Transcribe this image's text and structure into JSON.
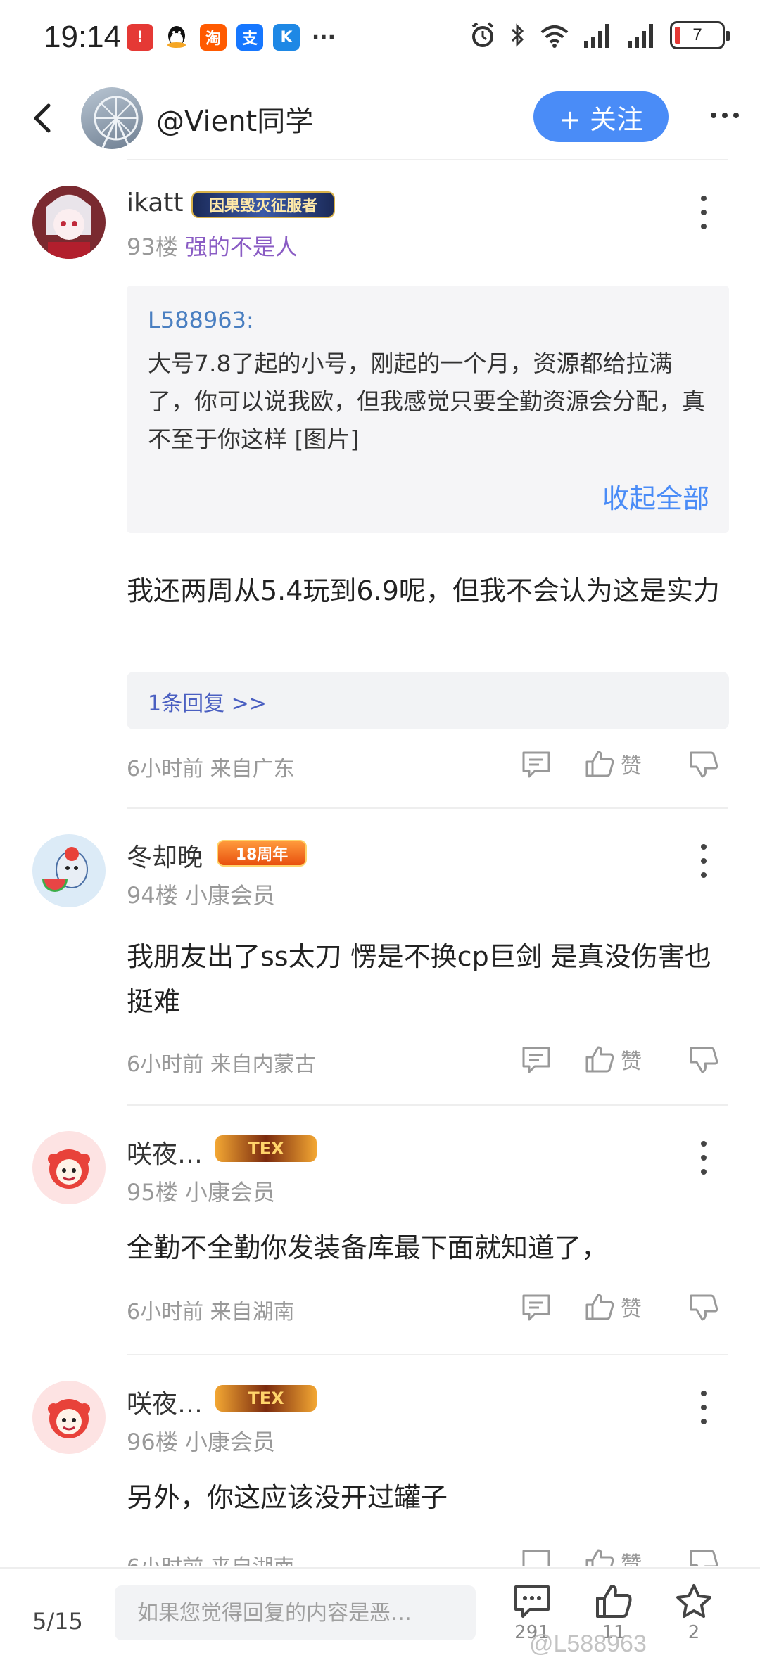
{
  "status_bar": {
    "time": "19:14",
    "notification_icons": [
      "warning-icon",
      "qq-icon",
      "taobao-icon",
      "alipay-icon",
      "app-icon",
      "more-dots-icon"
    ],
    "battery": "7"
  },
  "header": {
    "title": "@Vient同学",
    "follow_label": "+ 关注"
  },
  "posts": [
    {
      "username": "ikatt",
      "badge": "因果毁灭征服者",
      "floor": "93楼",
      "tag": "强的不是人",
      "quote": {
        "author": "L588963:",
        "text": "大号7.8了起的小号，刚起的一个月，资源都给拉满了，你可以说我欧，但我感觉只要全勤资源会分配，真不至于你这样 [图片]",
        "collapse_label": "收起全部"
      },
      "content": "我还两周从5.4玩到6.9呢，但我不会认为这是实力",
      "reply_link": "1条回复 >>",
      "time": "6小时前",
      "location": "来自广东",
      "like_label": "赞"
    },
    {
      "username": "冬却晚",
      "badge": "18周年",
      "floor": "94楼",
      "tag": "小康会员",
      "content": "我朋友出了ss太刀 愣是不换cp巨剑  是真没伤害也挺难",
      "time": "6小时前",
      "location": "来自内蒙古",
      "like_label": "赞"
    },
    {
      "username": "咲夜…",
      "badge": "TEX",
      "floor": "95楼",
      "tag": "小康会员",
      "content": "全勤不全勤你发装备库最下面就知道了，",
      "time": "6小时前",
      "location": "来自湖南",
      "like_label": "赞"
    },
    {
      "username": "咲夜…",
      "badge": "TEX",
      "floor": "96楼",
      "tag": "小康会员",
      "content": "另外，你这应该没开过罐子",
      "time": "6小时前",
      "location": "来自湖南",
      "like_label": "赞"
    }
  ],
  "bottom_bar": {
    "page": "5/15",
    "input_placeholder": "如果您觉得回复的内容是恶…",
    "comments_count": "291",
    "likes_count": "11",
    "favorites_count": "2"
  },
  "watermark": "@L588963",
  "colors": {
    "accent": "#4a8cf7",
    "tag_purple": "#8a5cc4",
    "quote_author": "#4a7fc1"
  }
}
